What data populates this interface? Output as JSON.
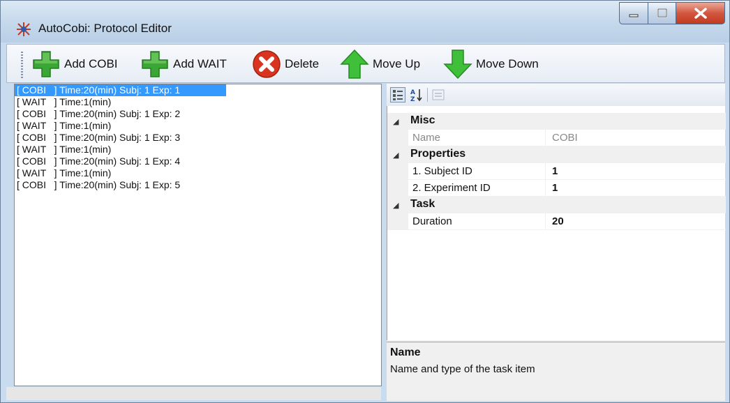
{
  "window": {
    "title": "AutoCobi: Protocol Editor"
  },
  "toolbar": {
    "add_cobi_label": "Add COBI",
    "add_wait_label": "Add WAIT",
    "delete_label": "Delete",
    "move_up_label": "Move Up",
    "move_down_label": "Move Down"
  },
  "task_list": {
    "items": [
      {
        "label": "[ COBI   ] Time:20(min) Subj: 1 Exp: 1",
        "selected": true
      },
      {
        "label": "[ WAIT   ] Time:1(min)",
        "selected": false
      },
      {
        "label": "[ COBI   ] Time:20(min) Subj: 1 Exp: 2",
        "selected": false
      },
      {
        "label": "[ WAIT   ] Time:1(min)",
        "selected": false
      },
      {
        "label": "[ COBI   ] Time:20(min) Subj: 1 Exp: 3",
        "selected": false
      },
      {
        "label": "[ WAIT   ] Time:1(min)",
        "selected": false
      },
      {
        "label": "[ COBI   ] Time:20(min) Subj: 1 Exp: 4",
        "selected": false
      },
      {
        "label": "[ WAIT   ] Time:1(min)",
        "selected": false
      },
      {
        "label": "[ COBI   ] Time:20(min) Subj: 1 Exp: 5",
        "selected": false
      }
    ]
  },
  "property_grid": {
    "categories": [
      {
        "label": "Misc"
      },
      {
        "label": "Properties"
      },
      {
        "label": "Task"
      }
    ],
    "rows": [
      {
        "name": "Name",
        "value": "COBI"
      },
      {
        "name": "1. Subject ID",
        "value": "1"
      },
      {
        "name": "2. Experiment ID",
        "value": "1"
      },
      {
        "name": "Duration",
        "value": "20"
      }
    ],
    "help_title": "Name",
    "help_description": "Name and type of the task item"
  },
  "colors": {
    "selection": "#3399ff",
    "add_green": "#3aa635",
    "delete_red": "#d9341f",
    "close_button": "#c23a1f"
  },
  "icons": {
    "add_cobi": "plus-icon",
    "add_wait": "plus-icon",
    "delete": "x-circle-icon",
    "move_up": "arrow-up-icon",
    "move_down": "arrow-down-icon"
  }
}
